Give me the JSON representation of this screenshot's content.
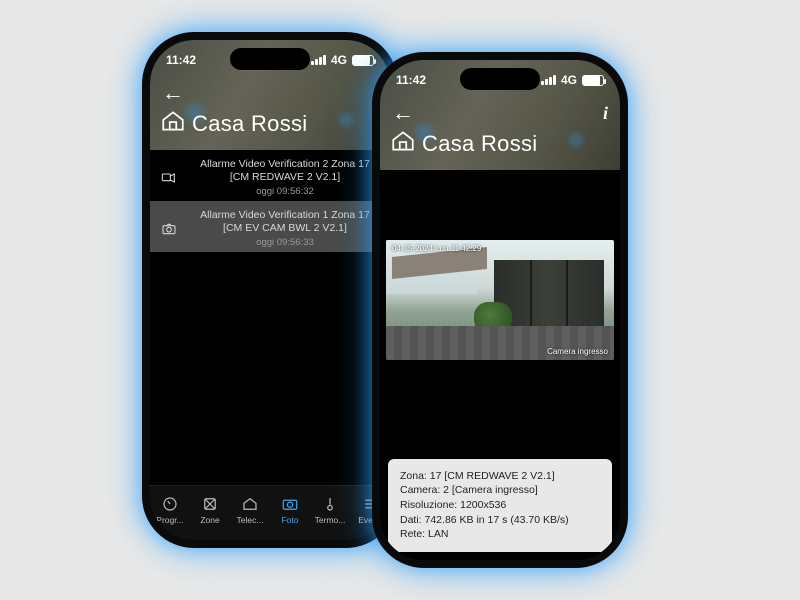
{
  "status": {
    "time": "11:42",
    "net": "4G"
  },
  "site_title": "Casa Rossi",
  "left": {
    "events": [
      {
        "title": "Allarme Video Verification 2 Zona 17",
        "subtitle": "[CM REDWAVE 2 V2.1]",
        "time": "oggi 09:56:32",
        "kind": "video"
      },
      {
        "title": "Allarme Video Verification 1 Zona 17",
        "subtitle": "[CM EV CAM BWL 2 V2.1]",
        "time": "oggi 09:56:33",
        "kind": "photo"
      }
    ],
    "tabs": [
      "Progr...",
      "Zone",
      "Telec...",
      "Foto",
      "Termo...",
      "Eventi"
    ]
  },
  "right": {
    "snapshot": {
      "overlay_tl": "04-15-2024  Lun  11:42:29",
      "overlay_br": "Camera ingresso"
    },
    "info": {
      "zona": "Zona: 17 [CM REDWAVE 2 V2.1]",
      "camera": "Camera: 2  [Camera ingresso]",
      "risoluzione": "Risoluzione: 1200x536",
      "dati": "Dati: 742.86 KB in 17 s (43.70 KB/s)",
      "rete": "Rete: LAN"
    }
  }
}
